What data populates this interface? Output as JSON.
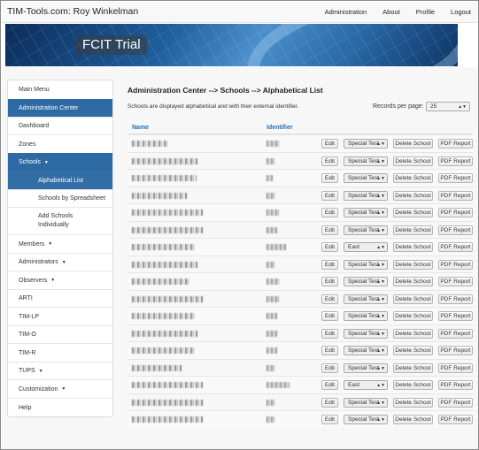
{
  "navbar": {
    "brand": "TIM-Tools.com: Roy Winkelman",
    "links": [
      "Administration",
      "About",
      "Profile",
      "Logout"
    ]
  },
  "banner": {
    "title": "FCIT Trial"
  },
  "sidebar": {
    "items": [
      {
        "label": "Main Menu",
        "state": "header"
      },
      {
        "label": "Administration Center",
        "state": "active"
      },
      {
        "label": "Dashboard",
        "state": "normal"
      },
      {
        "label": "Zones",
        "state": "normal"
      },
      {
        "label": "Schools",
        "state": "active",
        "caret": true
      },
      {
        "label": "Alphabetical List",
        "state": "subactive"
      },
      {
        "label": "Schools by Spreadsheet",
        "state": "sub"
      },
      {
        "label": "Add Schools Individually",
        "state": "sub"
      },
      {
        "label": "Members",
        "state": "normal",
        "caret": true
      },
      {
        "label": "Administrators",
        "state": "normal",
        "caret": true
      },
      {
        "label": "Observers",
        "state": "normal",
        "caret": true
      },
      {
        "label": "ARTI",
        "state": "normal"
      },
      {
        "label": "TIM-LP",
        "state": "normal"
      },
      {
        "label": "TIM-O",
        "state": "normal"
      },
      {
        "label": "TIM-R",
        "state": "normal"
      },
      {
        "label": "TUPS",
        "state": "normal",
        "caret": true
      },
      {
        "label": "Customization",
        "state": "normal",
        "caret": true
      },
      {
        "label": "Help",
        "state": "normal"
      }
    ]
  },
  "main": {
    "title": "Administration Center --> Schools --> Alphabetical List",
    "description": "Schools are displayed alphabetical and with their external identifier.",
    "records_label": "Records per page:",
    "records_value": "25",
    "columns": {
      "name": "Name",
      "identifier": "Identifier"
    },
    "buttons": {
      "edit": "Edit",
      "delete": "Delete School",
      "pdf": "PDF Report"
    },
    "rows": [
      {
        "template": "Special Test"
      },
      {
        "template": "Special Test"
      },
      {
        "template": "Special Test"
      },
      {
        "template": "Special Test"
      },
      {
        "template": "Special Test"
      },
      {
        "template": "Special Test"
      },
      {
        "template": "East"
      },
      {
        "template": "Special Test"
      },
      {
        "template": "Special Test"
      },
      {
        "template": "Special Test"
      },
      {
        "template": "Special Test"
      },
      {
        "template": "Special Test"
      },
      {
        "template": "Special Test"
      },
      {
        "template": "Special Test"
      },
      {
        "template": "East"
      },
      {
        "template": "Special Test"
      },
      {
        "template": "Special Test"
      }
    ]
  },
  "colors": {
    "accent": "#2d6aa4",
    "link": "#2a6db0"
  }
}
